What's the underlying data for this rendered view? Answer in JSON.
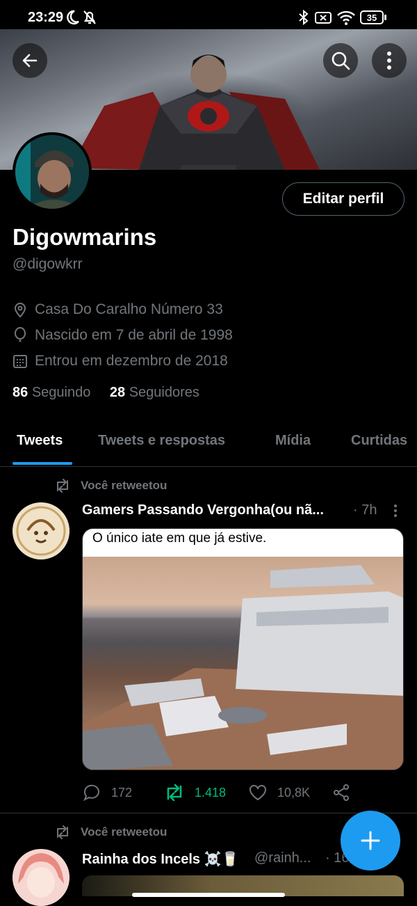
{
  "status": {
    "time": "23:29",
    "battery": "35"
  },
  "profile": {
    "name": "Digowmarins",
    "handle": "@digowkrr",
    "edit_label": "Editar perfil",
    "location": "Casa Do Caralho Número 33",
    "birth": "Nascido em 7 de abril de 1998",
    "joined": "Entrou em dezembro de 2018",
    "following_count": "86",
    "following_label": "Seguindo",
    "followers_count": "28",
    "followers_label": "Seguidores"
  },
  "tabs": [
    "Tweets",
    "Tweets e respostas",
    "Mídia",
    "Curtidas"
  ],
  "tweets": [
    {
      "retweet_label": "Você retweetou",
      "name": "Gamers Passando Vergonha(ou nã...",
      "time": "· 7h",
      "caption": "O único iate em que já estive.",
      "replies": "172",
      "retweets": "1.418",
      "likes": "10,8K"
    },
    {
      "retweet_label": "Você retweetou",
      "name": "Rainha dos Incels ☠️🥛",
      "handle": "@rainh...",
      "time": "· 16"
    }
  ],
  "colors": {
    "accent": "#1d9bf0",
    "retweet_green": "#00ba7c",
    "muted": "#71767b"
  }
}
